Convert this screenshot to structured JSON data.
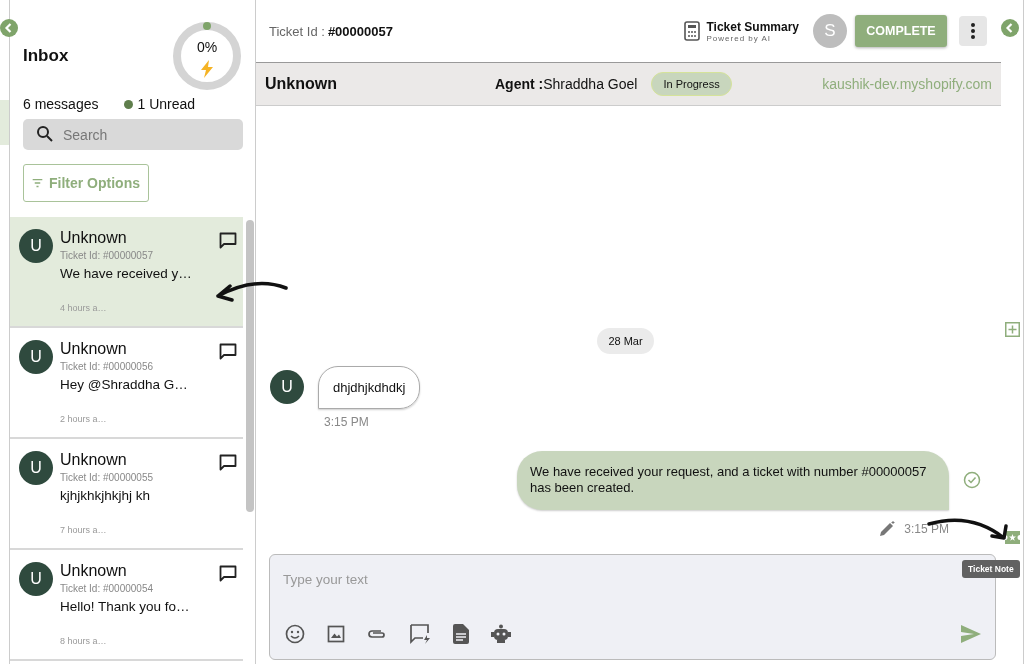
{
  "sidebar": {
    "title": "Inbox",
    "progress": {
      "level": 0,
      "label": "0%"
    },
    "message_count": "6 messages",
    "unread": "1 Unread",
    "search": {
      "placeholder": "Search"
    },
    "filter_button": "Filter Options",
    "conversations": [
      {
        "avatar": "U",
        "name": "Unknown",
        "ticket": "Ticket Id: #00000057",
        "preview": "We have received y…",
        "time": "4 hours a…",
        "selected": true
      },
      {
        "avatar": "U",
        "name": "Unknown",
        "ticket": "Ticket Id: #00000056",
        "preview": "Hey @Shraddha G…",
        "time": "2 hours a…",
        "selected": false
      },
      {
        "avatar": "U",
        "name": "Unknown",
        "ticket": "Ticket Id: #00000055",
        "preview": "kjhjkhkjhkjhj kh",
        "time": "7 hours a…",
        "selected": false
      },
      {
        "avatar": "U",
        "name": "Unknown",
        "ticket": "Ticket Id: #00000054",
        "preview": "Hello! Thank you fo…",
        "time": "8 hours a…",
        "selected": false
      }
    ]
  },
  "header": {
    "ticket_label": "Ticket Id :",
    "ticket_id": "#00000057",
    "summary_title": "Ticket Summary",
    "summary_subtitle": "Powered by AI",
    "avatar": "S",
    "complete_button": "COMPLETE"
  },
  "info_bar": {
    "customer": "Unknown",
    "agent_label": "Agent :",
    "agent": "Shraddha Goel",
    "status": "In Progress",
    "store": "kaushik-dev.myshopify.com"
  },
  "chat": {
    "date": "28 Mar",
    "messages": [
      {
        "kind": "incoming",
        "avatar": "U",
        "text": "dhjdhjkdhdkj",
        "time": "3:15 PM"
      },
      {
        "kind": "outgoing",
        "text": "We have received your request, and a ticket with number #00000057 has been created.",
        "time": "3:15 PM",
        "delivered": true
      }
    ]
  },
  "composer": {
    "placeholder": "Type your text"
  },
  "tooltip": "Ticket Note"
}
